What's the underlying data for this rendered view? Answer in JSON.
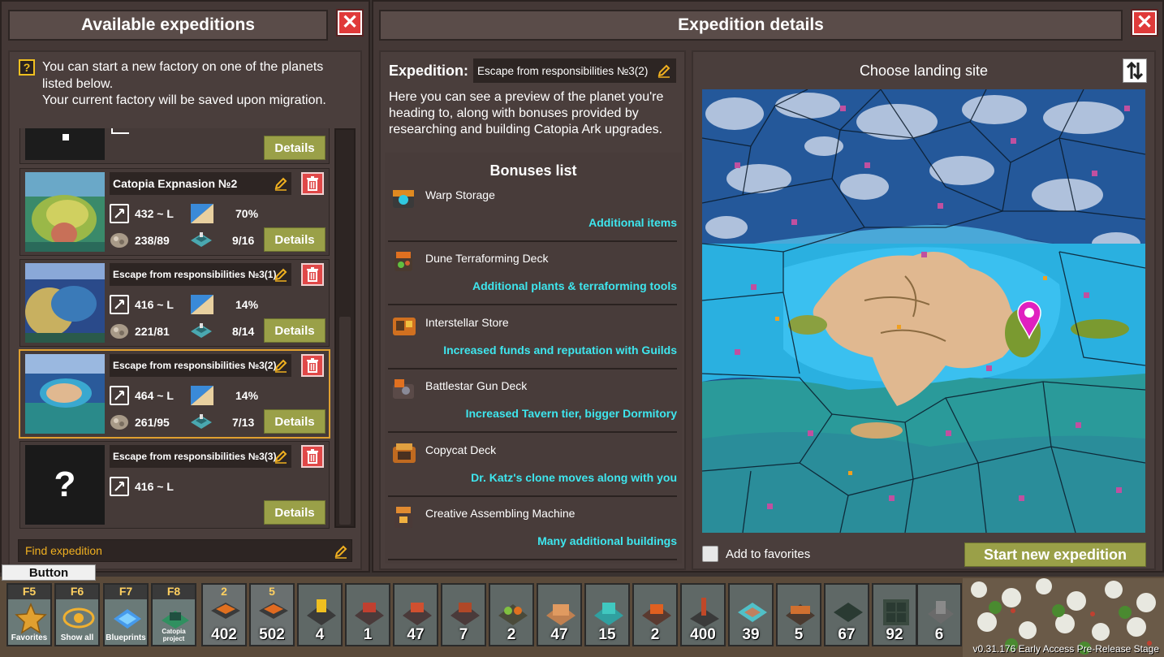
{
  "left_panel": {
    "title": "Available expeditions",
    "info_lines": [
      "You can start a new factory on one of the planets",
      "listed below.",
      "Your current factory will be saved upon migration."
    ],
    "details_label": "Details",
    "search_placeholder": "Find expedition",
    "cards": [
      {
        "name": "Catopia Expnasion №2",
        "size": "432 ~ L",
        "percent": "70%",
        "ratio": "238/89",
        "count": "9/16"
      },
      {
        "name": "Escape from responsibilities №3(1)",
        "size": "416 ~ L",
        "percent": "14%",
        "ratio": "221/81",
        "count": "8/14"
      },
      {
        "name": "Escape from responsibilities №3(2)",
        "size": "464 ~ L",
        "percent": "14%",
        "ratio": "261/95",
        "count": "7/13"
      },
      {
        "name": "Escape from responsibilities №3(3)",
        "size": "416 ~ L",
        "unknown_mark": "?"
      }
    ]
  },
  "right_panel": {
    "title": "Expedition details",
    "expedition_label": "Expedition:",
    "expedition_name": "Escape from responsibilities №3(2)",
    "description": "Here you can see a preview of the planet you're heading to, along with bonuses provided by researching and building Catopia Ark upgrades.",
    "bonuses_title": "Bonuses list",
    "bonuses": [
      {
        "name": "Warp Storage",
        "desc": "Additional items"
      },
      {
        "name": "Dune Terraforming Deck",
        "desc": "Additional plants & terraforming tools"
      },
      {
        "name": "Interstellar Store",
        "desc": "Increased funds and reputation with Guilds"
      },
      {
        "name": "Battlestar Gun Deck",
        "desc": "Increased Tavern tier, bigger Dormitory"
      },
      {
        "name": "Copycat Deck",
        "desc": "Dr. Katz's clone moves along with you"
      },
      {
        "name": "Creative Assembling Machine",
        "desc": "Many additional buildings"
      }
    ],
    "landing_title": "Choose landing site",
    "favorites_label": "Add to favorites",
    "start_button": "Start new expedition"
  },
  "tooltip": "Button",
  "hotbar": [
    {
      "key": "F5",
      "label": "Favorites",
      "color": "#e0a030"
    },
    {
      "key": "F6",
      "label": "Show all",
      "color": "#f0b030"
    },
    {
      "key": "F7",
      "label": "Blueprints",
      "color": "#40a0ff"
    },
    {
      "key": "F8",
      "label": "Catopia project",
      "color": "#309060"
    }
  ],
  "slots": [
    {
      "top": "2",
      "count": "402"
    },
    {
      "top": "5",
      "count": "502"
    },
    {
      "count": "4"
    },
    {
      "count": "1"
    },
    {
      "count": "47"
    },
    {
      "count": "7"
    },
    {
      "count": "2"
    },
    {
      "count": "47"
    },
    {
      "count": "15"
    },
    {
      "count": "2"
    },
    {
      "count": "400"
    },
    {
      "count": "39"
    },
    {
      "count": "5"
    },
    {
      "count": "67"
    },
    {
      "count": "92"
    },
    {
      "count": "6"
    }
  ],
  "version": "v0.31.176 Early Access Pre-Release Stage",
  "colors": {
    "accent_cyan": "#3ee6ee",
    "button_green": "#9aa048",
    "close_red": "#e03a3a",
    "selection_gold": "#e0a030",
    "marker": "#e020c0"
  }
}
